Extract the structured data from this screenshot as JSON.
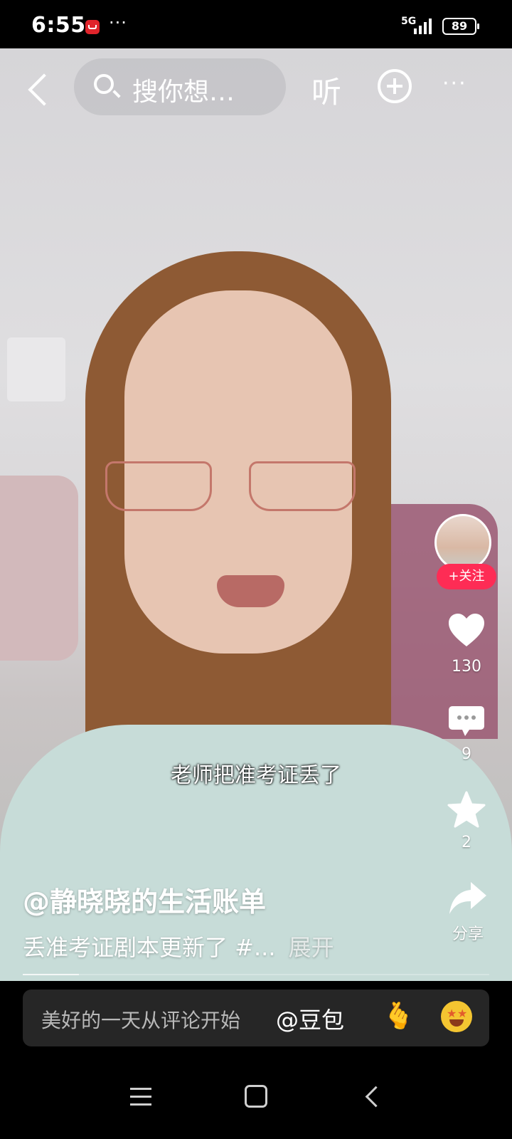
{
  "status_bar": {
    "time": "6:55",
    "more": "···",
    "network": "5G",
    "battery": "89"
  },
  "top_bar": {
    "search_placeholder": "搜你想…",
    "listen_label": "听",
    "more_label": "···"
  },
  "video": {
    "subtitle": "老师把准考证丢了",
    "author": "@静晓晓的生活账单",
    "description": "丢准考证剧本更新了 #...",
    "expand_label": "展开",
    "progress": 0.12
  },
  "actions": {
    "follow_label": "+关注",
    "likes": "130",
    "comments": "9",
    "favorites": "2",
    "share_label": "分享"
  },
  "comment_bar": {
    "placeholder": "美好的一天从评论开始",
    "mention": "@豆包"
  },
  "colors": {
    "follow": "#fe2c55",
    "background": "#000000"
  }
}
